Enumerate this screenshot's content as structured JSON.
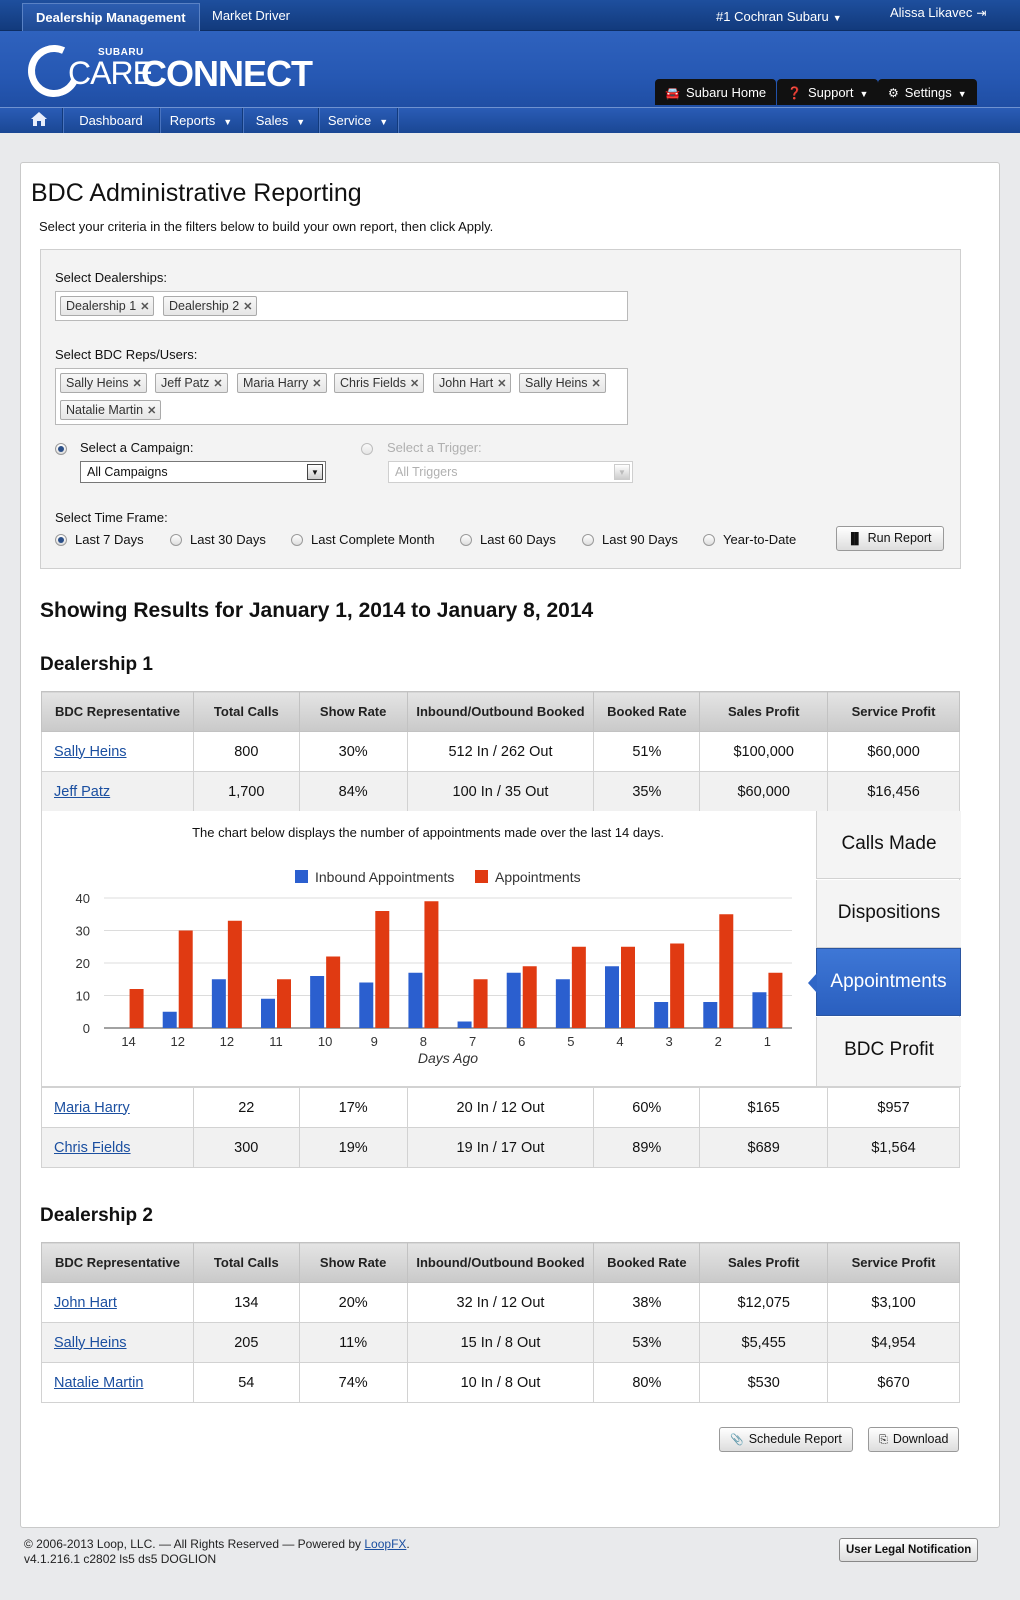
{
  "topbar": {
    "active_tab": "Dealership Management",
    "tab2": "Market Driver",
    "dealer": "#1 Cochran Subaru",
    "user": "Alissa Likavec"
  },
  "logo": {
    "small": "SUBARU",
    "care": "CARE",
    "connect": "CONNECT"
  },
  "header_buttons": {
    "home": "Subaru Home",
    "support": "Support",
    "settings": "Settings"
  },
  "nav": {
    "dashboard": "Dashboard",
    "reports": "Reports",
    "sales": "Sales",
    "service": "Service"
  },
  "page": {
    "title": "BDC Administrative Reporting",
    "intro": "Select your criteria in the filters below to build your own report, then click Apply."
  },
  "filters": {
    "dealerships_label": "Select Dealerships:",
    "dealerships": [
      "Dealership 1",
      "Dealership 2"
    ],
    "reps_label": "Select BDC Reps/Users:",
    "reps": [
      "Sally Heins",
      "Jeff Patz",
      "Maria Harry",
      "Chris Fields",
      "John Hart",
      "Sally Heins",
      "Natalie Martin"
    ],
    "campaign_label": "Select a Campaign:",
    "campaign_value": "All Campaigns",
    "trigger_label": "Select a Trigger:",
    "trigger_value": "All Triggers",
    "timeframe_label": "Select Time Frame:",
    "timeframes": [
      "Last 7 Days",
      "Last 30 Days",
      "Last Complete Month",
      "Last 60 Days",
      "Last 90 Days",
      "Year-to-Date"
    ],
    "selected_timeframe": "Last 7 Days",
    "run_button": "Run Report"
  },
  "results_title": "Showing Results for January 1, 2014 to January 8, 2014",
  "table_headers": [
    "BDC Representative",
    "Total Calls",
    "Show Rate",
    "Inbound/Outbound Booked",
    "Booked Rate",
    "Sales Profit",
    "Service Profit"
  ],
  "dealership1": {
    "title": "Dealership 1",
    "rows_top": [
      [
        "Sally Heins",
        "800",
        "30%",
        "512 In / 262 Out",
        "51%",
        "$100,000",
        "$60,000"
      ],
      [
        "Jeff Patz",
        "1,700",
        "84%",
        "100 In / 35 Out",
        "35%",
        "$60,000",
        "$16,456"
      ]
    ],
    "rows_bottom": [
      [
        "Maria Harry",
        "22",
        "17%",
        "20 In / 12 Out",
        "60%",
        "$165",
        "$957"
      ],
      [
        "Chris Fields",
        "300",
        "19%",
        "19 In / 17 Out",
        "89%",
        "$689",
        "$1,564"
      ]
    ]
  },
  "dealership2": {
    "title": "Dealership 2",
    "rows": [
      [
        "John Hart",
        "134",
        "20%",
        "32 In / 12 Out",
        "38%",
        "$12,075",
        "$3,100"
      ],
      [
        "Sally Heins",
        "205",
        "11%",
        "15 In / 8 Out",
        "53%",
        "$5,455",
        "$4,954"
      ],
      [
        "Natalie Martin",
        "54",
        "74%",
        "10 In / 8 Out",
        "80%",
        "$530",
        "$670"
      ]
    ]
  },
  "chart_caption": "The chart below displays the number of appointments made over the last 14 days.",
  "side_tabs": [
    "Calls Made",
    "Dispositions",
    "Appointments",
    "BDC Profit"
  ],
  "active_side_tab": "Appointments",
  "chart_data": {
    "type": "bar",
    "categories": [
      "14",
      "12",
      "12",
      "11",
      "10",
      "9",
      "8",
      "7",
      "6",
      "5",
      "4",
      "3",
      "2",
      "1"
    ],
    "series": [
      {
        "name": "Inbound Appointments",
        "color": "#2b5fcf",
        "values": [
          0,
          5,
          15,
          9,
          16,
          14,
          17,
          2,
          17,
          15,
          19,
          8,
          8,
          11
        ]
      },
      {
        "name": "Appointments",
        "color": "#e03a12",
        "values": [
          12,
          30,
          33,
          15,
          22,
          36,
          39,
          15,
          19,
          25,
          25,
          26,
          35,
          17
        ]
      }
    ],
    "xlabel": "Days Ago",
    "ylabel": "",
    "ylim": [
      0,
      40
    ],
    "yticks": [
      0,
      10,
      20,
      30,
      40
    ],
    "legend": "top-center",
    "grid": true
  },
  "actions": {
    "schedule": "Schedule Report",
    "download": "Download"
  },
  "footer": {
    "copyright": "© 2006-2013 Loop, LLC. — All Rights Reserved — Powered by",
    "powered_link": "LoopFX",
    "period": ".",
    "version": "v4.1.216.1 c2802 ls5 ds5 DOGLION",
    "legal_button": "User Legal Notification"
  }
}
